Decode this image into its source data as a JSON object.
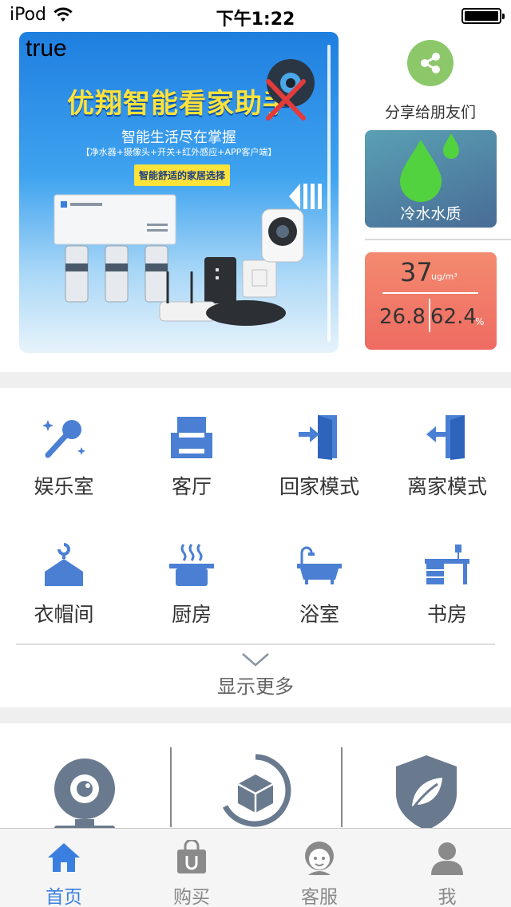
{
  "status_bar": {
    "carrier": "iPod",
    "time": "下午1:22"
  },
  "banner": {
    "debug_flag": "true",
    "headline": "优翔智能看家助手",
    "subtitle": "智能生活尽在掌握",
    "features": "【净水器+摄像头+开关+红外感应+APP客户端】",
    "tagline": "智能舒适的家居选择"
  },
  "side": {
    "share_label": "分享给朋友们",
    "water_label": "冷水水质",
    "air": {
      "pm25": "37",
      "pm25_unit": "ug/m³",
      "temperature": "26.8",
      "humidity": "62.4",
      "humidity_unit": "%"
    }
  },
  "rooms": [
    {
      "label": "娱乐室",
      "icon": "microphone-icon"
    },
    {
      "label": "客厅",
      "icon": "sofa-icon"
    },
    {
      "label": "回家模式",
      "icon": "door-enter-icon"
    },
    {
      "label": "离家模式",
      "icon": "door-exit-icon"
    },
    {
      "label": "衣帽间",
      "icon": "hanger-icon"
    },
    {
      "label": "厨房",
      "icon": "cooking-pot-icon"
    },
    {
      "label": "浴室",
      "icon": "bathtub-icon"
    },
    {
      "label": "书房",
      "icon": "desk-icon"
    }
  ],
  "show_more": "显示更多",
  "features": [
    {
      "icon": "camera-icon"
    },
    {
      "icon": "cube-icon"
    },
    {
      "icon": "shield-leaf-icon"
    }
  ],
  "tabs": [
    {
      "label": "首页",
      "icon": "home-icon",
      "active": true
    },
    {
      "label": "购买",
      "icon": "shopping-bag-icon",
      "active": false
    },
    {
      "label": "客服",
      "icon": "customer-service-icon",
      "active": false
    },
    {
      "label": "我",
      "icon": "user-icon",
      "active": false
    }
  ],
  "colors": {
    "accent": "#3a7fe0",
    "icon_blue": "#4a7fd4",
    "share_green": "#8cc86a",
    "feature_gray": "#6a7a8e"
  }
}
